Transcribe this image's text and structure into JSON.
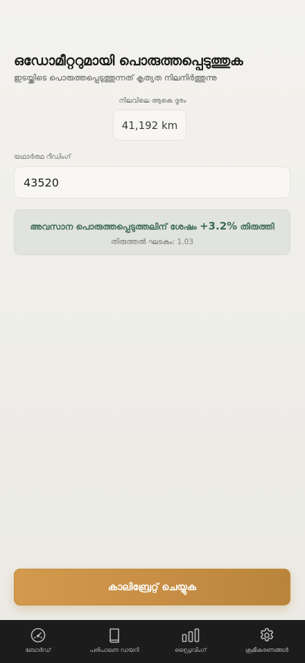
{
  "header": {
    "title": "ഒഡോമീറ്ററുമായി പൊരുത്തപ്പെടുത്തുക",
    "subtitle": "ഇടയ്ക്കിടെ പൊരുത്തപ്പെടുത്തുന്നത് കൃത്യത നിലനിർത്തുന്നു"
  },
  "odometer": {
    "label": "നിലവിലെ ആകെ ദൂരം",
    "value": "41,192 km"
  },
  "reading": {
    "label": "യഥാർത്ഥ റീഡിംഗ്",
    "value": "43520"
  },
  "info": {
    "text_before": "അവസാന പൊരുത്തപ്പെടുത്തലിന് ശേഷം ",
    "percent": "+3.2%",
    "text_after": " തിരുത്തി",
    "factor_label": "തിരുത്തൽ ഘടകം: 1.03"
  },
  "actions": {
    "calibrate_label": "കാലിബ്രേറ്റ് ചെയ്യുക"
  },
  "tabbar": {
    "items": [
      {
        "label": "ബോർഡ്",
        "icon": "gauge-icon"
      },
      {
        "label": "പരിപാലന ഡയറി",
        "icon": "book-icon"
      },
      {
        "label": "ഡ്രൈവിംഗ്",
        "icon": "bar-chart-icon"
      },
      {
        "label": "ക്രമീകരണങ്ങൾ",
        "icon": "gear-icon"
      }
    ]
  },
  "colors": {
    "accent": "#c88f45",
    "info_text": "#3d6a5a",
    "tabbar_bg": "#1c1c1c"
  }
}
